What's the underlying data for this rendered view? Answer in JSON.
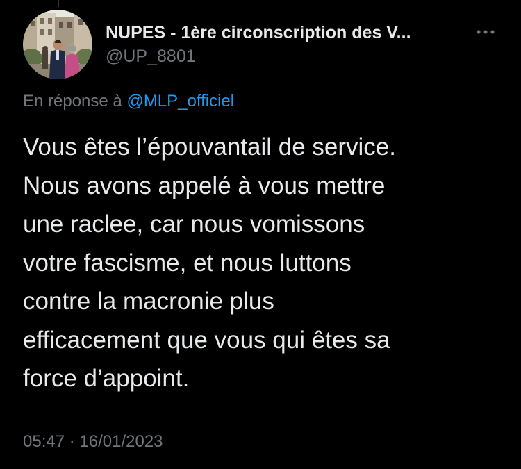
{
  "tweet": {
    "display_name": "NUPES - 1ère circonscription des V...",
    "handle": "@UP_8801",
    "more_icon": "more-horizontal-icon",
    "reply_prefix": "En réponse à",
    "reply_mention": "@MLP_officiel",
    "text_lines": [
      "Vous êtes l’épouvantail de service.",
      "Nous avons appelé à vous mettre",
      "une raclee, car nous vomissons",
      "votre fascisme, et nous luttons",
      "contre la macronie plus",
      "efficacement que vous qui êtes sa",
      "force d’appoint."
    ],
    "time": "05:47",
    "separator": "·",
    "date": "16/01/2023"
  },
  "colors": {
    "background": "#000000",
    "primary_text": "#e7e9ea",
    "secondary_text": "#71767b",
    "accent": "#1d9bf0"
  }
}
